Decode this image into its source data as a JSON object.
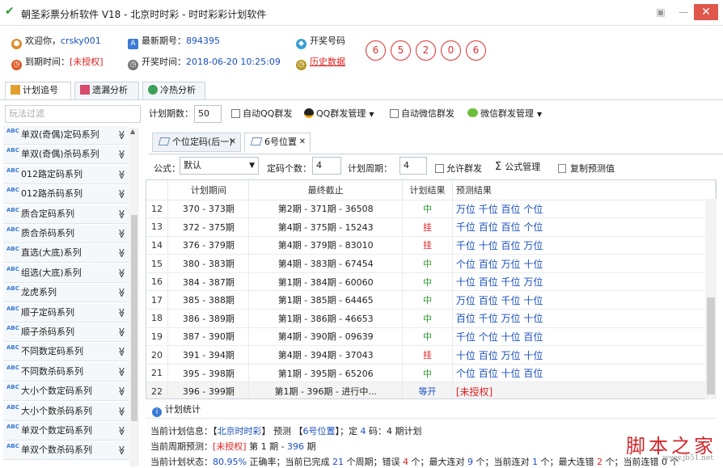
{
  "window": {
    "title": "朝圣彩票分析软件 V18 - 北京时时彩 - 时时彩彩计划软件"
  },
  "info": {
    "welcome_prefix": "欢迎你，",
    "username": "crsky001",
    "latest_issue_label": "最新期号：",
    "latest_issue": "894395",
    "draw_label": "开奖号码",
    "expire_label": "到期时间：",
    "expire_value": "[未授权]",
    "open_time_label": "开奖时间：",
    "open_time": "2018-06-20 10:25:09",
    "history_link": "历史数据",
    "balls": [
      "6",
      "5",
      "2",
      "0",
      "6"
    ]
  },
  "tabs": [
    "计划追号",
    "遗漏分析",
    "冷热分析"
  ],
  "filter_placeholder": "玩法过滤",
  "sidebar": [
    "单双(奇偶)定码系列",
    "单双(奇偶)杀码系列",
    "012路定码系列",
    "012路杀码系列",
    "质合定码系列",
    "质合杀码系列",
    "直选(大底)系列",
    "组选(大底)系列",
    "龙虎系列",
    "顺子定码系列",
    "顺子杀码系列",
    "不同数定码系列",
    "不同数杀码系列",
    "大小个数定码系列",
    "大小个数杀码系列",
    "单双个数定码系列",
    "单双个数杀码系列"
  ],
  "toolbar": {
    "plan_periods_label": "计划期数：",
    "plan_periods": "50",
    "auto_qq": "自动QQ群发",
    "qq_manage": "QQ群发管理",
    "auto_wechat": "自动微信群发",
    "wechat_manage": "微信群发管理"
  },
  "doc_tabs": [
    "个位定码(后一)",
    "6号位置"
  ],
  "params": {
    "formula_label": "公式：",
    "formula_value": "默认",
    "code_count_label": "定码个数：",
    "code_count": "4",
    "cycle_label": "计划周期：",
    "cycle": "4",
    "allow_group": "允许群发",
    "formula_manage": "公式管理",
    "copy_predict": "复制预测值"
  },
  "grid": {
    "headers": [
      "",
      "计划期间",
      "最终截止",
      "计划结果",
      "预测结果"
    ],
    "rows": [
      {
        "n": "12",
        "period": "370 - 373期",
        "end": "第2期 - 371期 - 36508",
        "result": "中",
        "rc": "green",
        "pred": "万位 千位 百位 个位",
        "pc": "blue"
      },
      {
        "n": "13",
        "period": "372 - 375期",
        "end": "第4期 - 375期 - 15243",
        "result": "挂",
        "rc": "red",
        "pred": "千位 百位 百位 个位",
        "pc": "blue"
      },
      {
        "n": "14",
        "period": "376 - 379期",
        "end": "第4期 - 379期 - 83010",
        "result": "挂",
        "rc": "red",
        "pred": "千位 十位 百位 万位",
        "pc": "blue"
      },
      {
        "n": "15",
        "period": "380 - 383期",
        "end": "第4期 - 383期 - 67454",
        "result": "中",
        "rc": "green",
        "pred": "个位 百位 万位 十位",
        "pc": "blue"
      },
      {
        "n": "16",
        "period": "384 - 387期",
        "end": "第1期 - 384期 - 60060",
        "result": "中",
        "rc": "green",
        "pred": "十位 百位 千位 万位",
        "pc": "blue"
      },
      {
        "n": "17",
        "period": "385 - 388期",
        "end": "第1期 - 385期 - 64465",
        "result": "中",
        "rc": "green",
        "pred": "万位 百位 千位 十位",
        "pc": "blue"
      },
      {
        "n": "18",
        "period": "386 - 389期",
        "end": "第1期 - 386期 - 46653",
        "result": "中",
        "rc": "green",
        "pred": "百位 千位 万位 十位",
        "pc": "blue"
      },
      {
        "n": "19",
        "period": "387 - 390期",
        "end": "第4期 - 390期 - 09639",
        "result": "中",
        "rc": "green",
        "pred": "千位 个位 十位 百位",
        "pc": "blue"
      },
      {
        "n": "20",
        "period": "391 - 394期",
        "end": "第4期 - 394期 - 37043",
        "result": "挂",
        "rc": "red",
        "pred": "十位 百位 万位 十位",
        "pc": "blue"
      },
      {
        "n": "21",
        "period": "395 - 398期",
        "end": "第1期 - 395期 - 65206",
        "result": "中",
        "rc": "green",
        "pred": "个位 百位 十位 百位",
        "pc": "blue"
      },
      {
        "n": "22",
        "period": "396 - 399期",
        "end": "第1期 - 396期 - 进行中...",
        "result": "等开",
        "rc": "blue",
        "pred": "[未授权]",
        "pc": "red"
      }
    ]
  },
  "stats": {
    "header": "计划统计",
    "line1": {
      "a": "当前计划信息：【",
      "lottery": "北京时时彩",
      "b": "】 预测 【",
      "pos": "6号位置",
      "c": "】；定 ",
      "n": "4",
      "d": " 码：4 期计划"
    },
    "line2": {
      "a": "当前周期预测：",
      "auth": "[未授权]",
      "b": " 第 1 期 - ",
      "issue": "396",
      "c": " 期"
    },
    "line3": {
      "a": "当前计划状态：",
      "rate": "80.95%",
      "b": " 正确率；当前已完成 ",
      "done": "21",
      "c": " 个周期；错误 ",
      "err": "4",
      "d": " 个；最大连对 ",
      "maxw": "9",
      "e": " 个；当前连对 ",
      "curw": "1",
      "f": " 个；最大连错 ",
      "maxl": "2",
      "g": " 个；当前连错 0 个"
    }
  },
  "watermark": {
    "big": "脚本之家",
    "small": "www.jb51.net"
  }
}
